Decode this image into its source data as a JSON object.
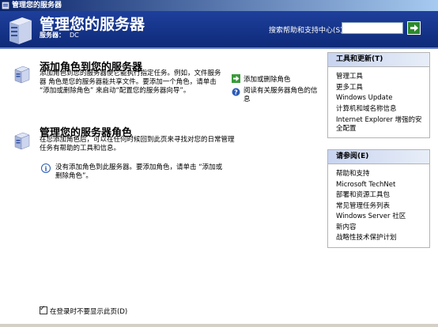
{
  "window": {
    "title": "管理您的服务器"
  },
  "header": {
    "title": "管理您的服务器",
    "server_label": "服务器：",
    "server_name": "DC",
    "search_label": "搜索帮助和支持中心(S)",
    "search_value": ""
  },
  "add_role": {
    "title": "添加角色到您的服务器",
    "description": "添加角色到您的服务器使它能执行指定任务。例如，文件服务器 角色是您的服务器能共享文件。要添加一个角色，请单击 “添加或删除角色” 来启动“配置您的服务器向导”。",
    "links": [
      {
        "label": "添加或删除角色",
        "icon": "green-arrow-icon"
      },
      {
        "label": "阅读有关服务器角色的信息",
        "icon": "help-icon"
      }
    ]
  },
  "manage_roles": {
    "title": "管理您的服务器角色",
    "description": "在您添加角色后，可以在任何时候回到此页来寻找对您的日常管理任务有帮助的工具和信息。",
    "info": "没有添加角色到此服务器。要添加角色，请单击 “添加或删除角色”。"
  },
  "tools_panel": {
    "title": "工具和更新(T)",
    "items": [
      "管理工具",
      "更多工具",
      "Windows Update",
      "计算机和域名称信息",
      "Internet Explorer 增强的安全配置"
    ]
  },
  "see_also_panel": {
    "title": "请参阅(E)",
    "items": [
      "帮助和支持",
      "Microsoft TechNet",
      "部署和资源工具包",
      "常见管理任务列表",
      "Windows Server 社区",
      "新内容",
      "战略性技术保护计划"
    ]
  },
  "footer": {
    "checkbox_label": "在登录时不要显示此页(D)",
    "checked": true
  },
  "colors": {
    "header_bg": "#1e3f9c",
    "go_button": "#2d8a2d"
  }
}
